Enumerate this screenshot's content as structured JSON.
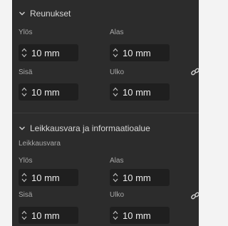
{
  "margins": {
    "title": "Reunukset",
    "top_label": "Ylös",
    "bottom_label": "Alas",
    "inside_label": "Sisä",
    "outside_label": "Ulko",
    "top_value": "10 mm",
    "bottom_value": "10 mm",
    "inside_value": "10 mm",
    "outside_value": "10 mm",
    "link_icon": "chain-link-icon"
  },
  "bleed": {
    "title": "Leikkausvara ja informaatioalue",
    "sublabel": "Leikkausvara",
    "top_label": "Ylös",
    "bottom_label": "Alas",
    "inside_label": "Sisä",
    "outside_label": "Ulko",
    "top_value": "10 mm",
    "bottom_value": "10 mm",
    "inside_value": "10 mm",
    "outside_value": "10 mm",
    "link_icon": "chain-link-icon"
  },
  "colors": {
    "panel_bg": "#2c2c2c",
    "field_bg": "#1f1f1f",
    "text": "#e6e6e6",
    "label": "#a8a8a8"
  }
}
